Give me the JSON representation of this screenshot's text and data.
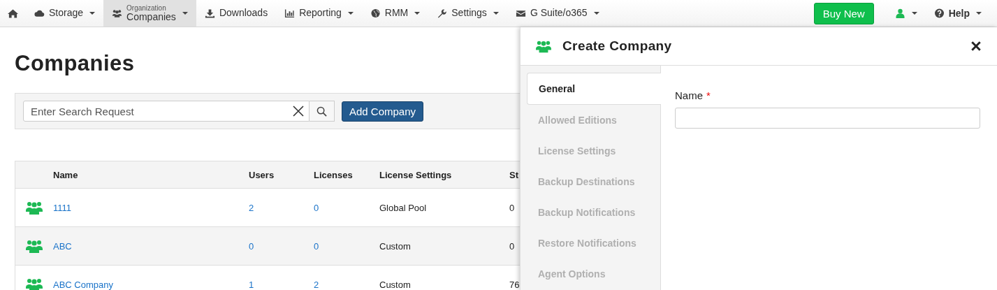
{
  "navbar": {
    "items": [
      {
        "label": "Storage",
        "dropdown": true,
        "selected": false
      },
      {
        "sublabel": "Organization",
        "label": "Companies",
        "dropdown": true,
        "selected": true
      },
      {
        "label": "Downloads",
        "dropdown": false,
        "selected": false
      },
      {
        "label": "Reporting",
        "dropdown": true,
        "selected": false
      },
      {
        "label": "RMM",
        "dropdown": true,
        "selected": false
      },
      {
        "label": "Settings",
        "dropdown": true,
        "selected": false
      },
      {
        "label": "G Suite/o365",
        "dropdown": true,
        "selected": false
      }
    ],
    "buy_button": "Buy New",
    "help": "Help"
  },
  "page": {
    "title": "Companies",
    "search": {
      "placeholder": "Enter Search Request"
    },
    "add_button": "Add Company"
  },
  "table": {
    "columns": [
      "Name",
      "Users",
      "Licenses",
      "License Settings",
      "St"
    ],
    "rows": [
      {
        "name": "1111",
        "users": "2",
        "licenses": "0",
        "license_settings": "Global Pool",
        "column_5": "0"
      },
      {
        "name": "ABC",
        "users": "0",
        "licenses": "0",
        "license_settings": "Custom",
        "column_5": "0"
      },
      {
        "name": "ABC Company",
        "users": "1",
        "licenses": "2",
        "license_settings": "Custom",
        "column_5": "76"
      }
    ]
  },
  "panel": {
    "title": "Create Company",
    "tabs": [
      {
        "label": "General",
        "selected": true
      },
      {
        "label": "Allowed Editions",
        "selected": false
      },
      {
        "label": "License Settings",
        "selected": false
      },
      {
        "label": "Backup Destinations",
        "selected": false
      },
      {
        "label": "Backup Notifications",
        "selected": false
      },
      {
        "label": "Restore Notifications",
        "selected": false
      },
      {
        "label": "Agent Options",
        "selected": false
      }
    ],
    "field": {
      "label": "Name",
      "required_mark": "*"
    }
  }
}
